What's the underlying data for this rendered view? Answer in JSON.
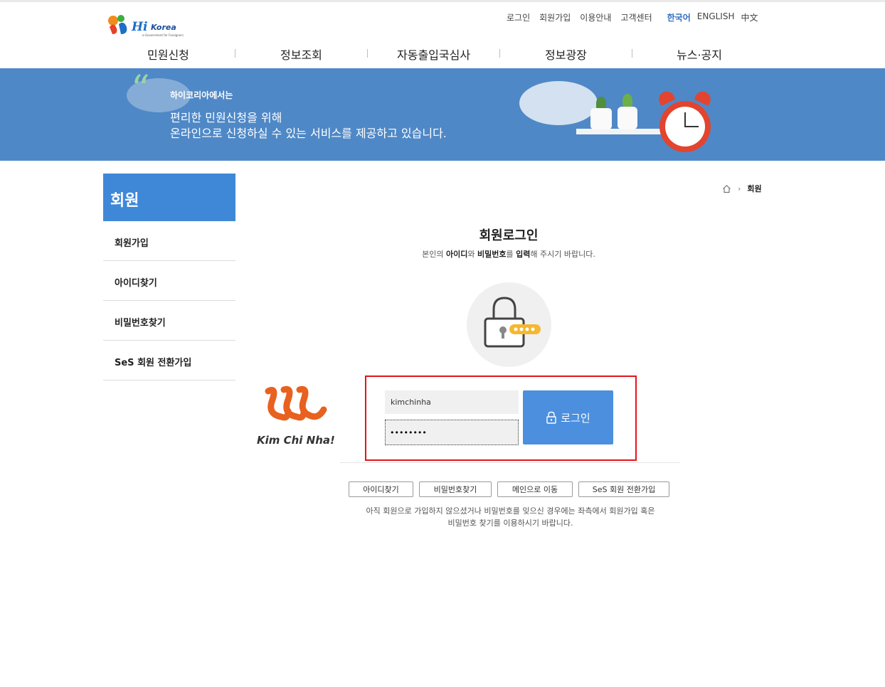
{
  "brand": {
    "logo_word": "Hi",
    "logo_word2": "Korea",
    "logo_sub": "e-Government for Foreigners"
  },
  "util_nav": {
    "login": "로그인",
    "signup": "회원가입",
    "guide": "이용안내",
    "support": "고객센터",
    "lang_ko": "한국어",
    "lang_en": "ENGLISH",
    "lang_zh": "中文"
  },
  "gnb": [
    "민원신청",
    "정보조회",
    "자동출입국심사",
    "정보광장",
    "뉴스·공지"
  ],
  "banner": {
    "small": "하이코리아에서는",
    "line1": "편리한 민원신청을 위해",
    "line2": "온라인으로 신청하실 수 있는 서비스를 제공하고 있습니다.",
    "quote_mark": "“"
  },
  "sidebar": {
    "title": "회원",
    "items": [
      {
        "label": "회원가입"
      },
      {
        "label": "아이디찾기"
      },
      {
        "label": "비밀번호찾기"
      },
      {
        "label": "SeS 회원 전환가입"
      }
    ]
  },
  "breadcrumb": {
    "sep": "›",
    "current": "회원"
  },
  "login": {
    "title": "회원로그인",
    "sub_1": "본인의 ",
    "sub_b1": "아이디",
    "sub_2": "와 ",
    "sub_b2": "비밀번호",
    "sub_3": "를 ",
    "sub_b3": "입력",
    "sub_4": "해 주시기 바랍니다.",
    "id_value": "kimchinha",
    "pw_value": "••••••••",
    "button_label": "로그인"
  },
  "sub_buttons": [
    {
      "label": "아이디찾기"
    },
    {
      "label": "비밀번호찾기"
    },
    {
      "label": "메인으로 이동"
    },
    {
      "label": "SeS 회원 전환가입"
    }
  ],
  "notice": {
    "line1": "아직 회원으로 가입하지 않으셨거나 비밀번호를 잊으신 경우에는 좌측에서 회원가입 혹은",
    "line2": "비밀번호 찾기를 이용하시기 바랍니다."
  },
  "watermark": {
    "text": "Kim Chi Nha!"
  },
  "colors": {
    "accent": "#3f88d8",
    "banner": "#4f88c6",
    "highlight": "#e3141b",
    "login_button": "#4b8fde",
    "lang_active": "#2f6fc1"
  },
  "icons": [
    "home-icon",
    "lock-icon",
    "padlock-illustration",
    "kimchinha-logo"
  ]
}
